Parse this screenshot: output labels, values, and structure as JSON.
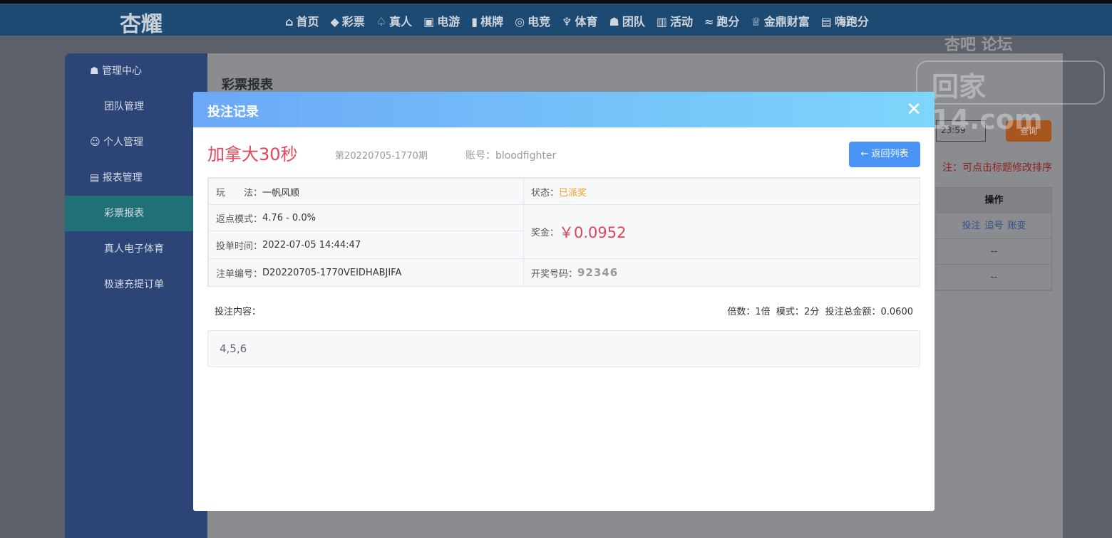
{
  "header": {
    "logo": "杏耀",
    "nav": [
      "首页",
      "彩票",
      "真人",
      "电游",
      "棋牌",
      "电竞",
      "体育",
      "团队",
      "活动",
      "跑分",
      "金鼎财富",
      "嗨跑分"
    ]
  },
  "sidebar": {
    "items": [
      {
        "label": "管理中心",
        "type": "group"
      },
      {
        "label": "团队管理",
        "type": "sub"
      },
      {
        "label": "个人管理",
        "type": "group"
      },
      {
        "label": "报表管理",
        "type": "group"
      },
      {
        "label": "彩票报表",
        "type": "sub",
        "active": true
      },
      {
        "label": "真人电子体育",
        "type": "sub"
      },
      {
        "label": "极速充提订单",
        "type": "sub"
      }
    ]
  },
  "main": {
    "title": "彩票报表",
    "date_value": "23:59",
    "query_label": "查询",
    "note": "注：可点击标题修改排序",
    "table": {
      "header": "操作",
      "row_links": [
        "投注",
        "追号",
        "账变"
      ],
      "empty_rows": [
        "--",
        "--"
      ]
    }
  },
  "watermark": {
    "top": "杏吧 论坛",
    "main": "回家14.com"
  },
  "modal": {
    "title": "投注记录",
    "close": "✕",
    "lottery": "加拿大30秒",
    "issue": "第20220705-1770期",
    "account_label": "账号：",
    "account": "bloodfighter",
    "back_label": "← 返回列表",
    "play_label": "玩　　法：",
    "play": "一帆风顺",
    "status_label": "状态：",
    "status": "已派奖",
    "rebate_label": "返点模式：",
    "rebate": "4.76 - 0.0%",
    "prize_label": "奖金：",
    "prize": "￥0.0952",
    "time_label": "投单时间：",
    "time": "2022-07-05 14:44:47",
    "order_label": "注单编号：",
    "order": "D20220705-1770VEIDHABJIFA",
    "draw_label": "开奖号码：",
    "draw": "92346",
    "content_label": "投注内容：",
    "multiple_label": "倍数：",
    "multiple": "1倍",
    "mode_label": "模式：",
    "mode": "2分",
    "total_label": "投注总金额：",
    "total": "0.0600",
    "content": "4,5,6",
    "colors": {
      "accent": "#e0455a",
      "status": "#f0a020",
      "button": "#4a94f5"
    }
  }
}
